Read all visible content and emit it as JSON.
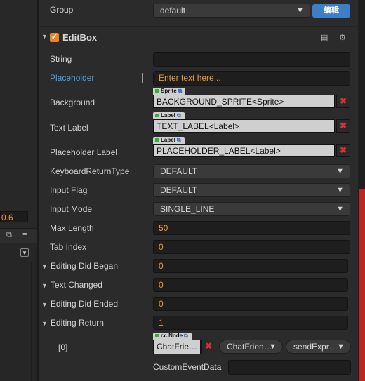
{
  "left": {
    "value": "0.6",
    "panel_icons": [
      "copy-icon",
      "menu-icon"
    ],
    "toggle_icon": "dropdown-box-icon"
  },
  "group_row": {
    "label": "Group",
    "value": "default",
    "button": "编辑"
  },
  "component": {
    "title": "EditBox",
    "enabled": true
  },
  "fields": {
    "string": {
      "label": "String",
      "value": ""
    },
    "placeholder": {
      "label": "Placeholder",
      "value": "Enter text here..."
    },
    "background": {
      "label": "Background",
      "tag": "Sprite",
      "value": "BACKGROUND_SPRITE<Sprite>"
    },
    "text_label": {
      "label": "Text Label",
      "tag": "Label",
      "value": "TEXT_LABEL<Label>"
    },
    "placeholder_label": {
      "label": "Placeholder Label",
      "tag": "Label",
      "value": "PLACEHOLDER_LABEL<Label>"
    },
    "keyboard_return_type": {
      "label": "KeyboardReturnType",
      "value": "DEFAULT"
    },
    "input_flag": {
      "label": "Input Flag",
      "value": "DEFAULT"
    },
    "input_mode": {
      "label": "Input Mode",
      "value": "SINGLE_LINE"
    },
    "max_length": {
      "label": "Max Length",
      "value": "50"
    },
    "tab_index": {
      "label": "Tab Index",
      "value": "0"
    },
    "editing_did_began": {
      "label": "Editing Did Began",
      "value": "0"
    },
    "text_changed": {
      "label": "Text Changed",
      "value": "0"
    },
    "editing_did_ended": {
      "label": "Editing Did Ended",
      "value": "0"
    },
    "editing_return": {
      "label": "Editing Return",
      "value": "1"
    }
  },
  "event_item": {
    "index": "[0]",
    "tag": "cc.Node",
    "target": "ChatFrie…",
    "component": "ChatFrien…",
    "handler": "sendExpr…",
    "custom_label": "CustomEventData",
    "custom_value": ""
  },
  "colors": {
    "accent": "#e69a3c",
    "highlight": "#3fa3f2",
    "remove": "#d83131",
    "button": "#3d7ec8"
  }
}
